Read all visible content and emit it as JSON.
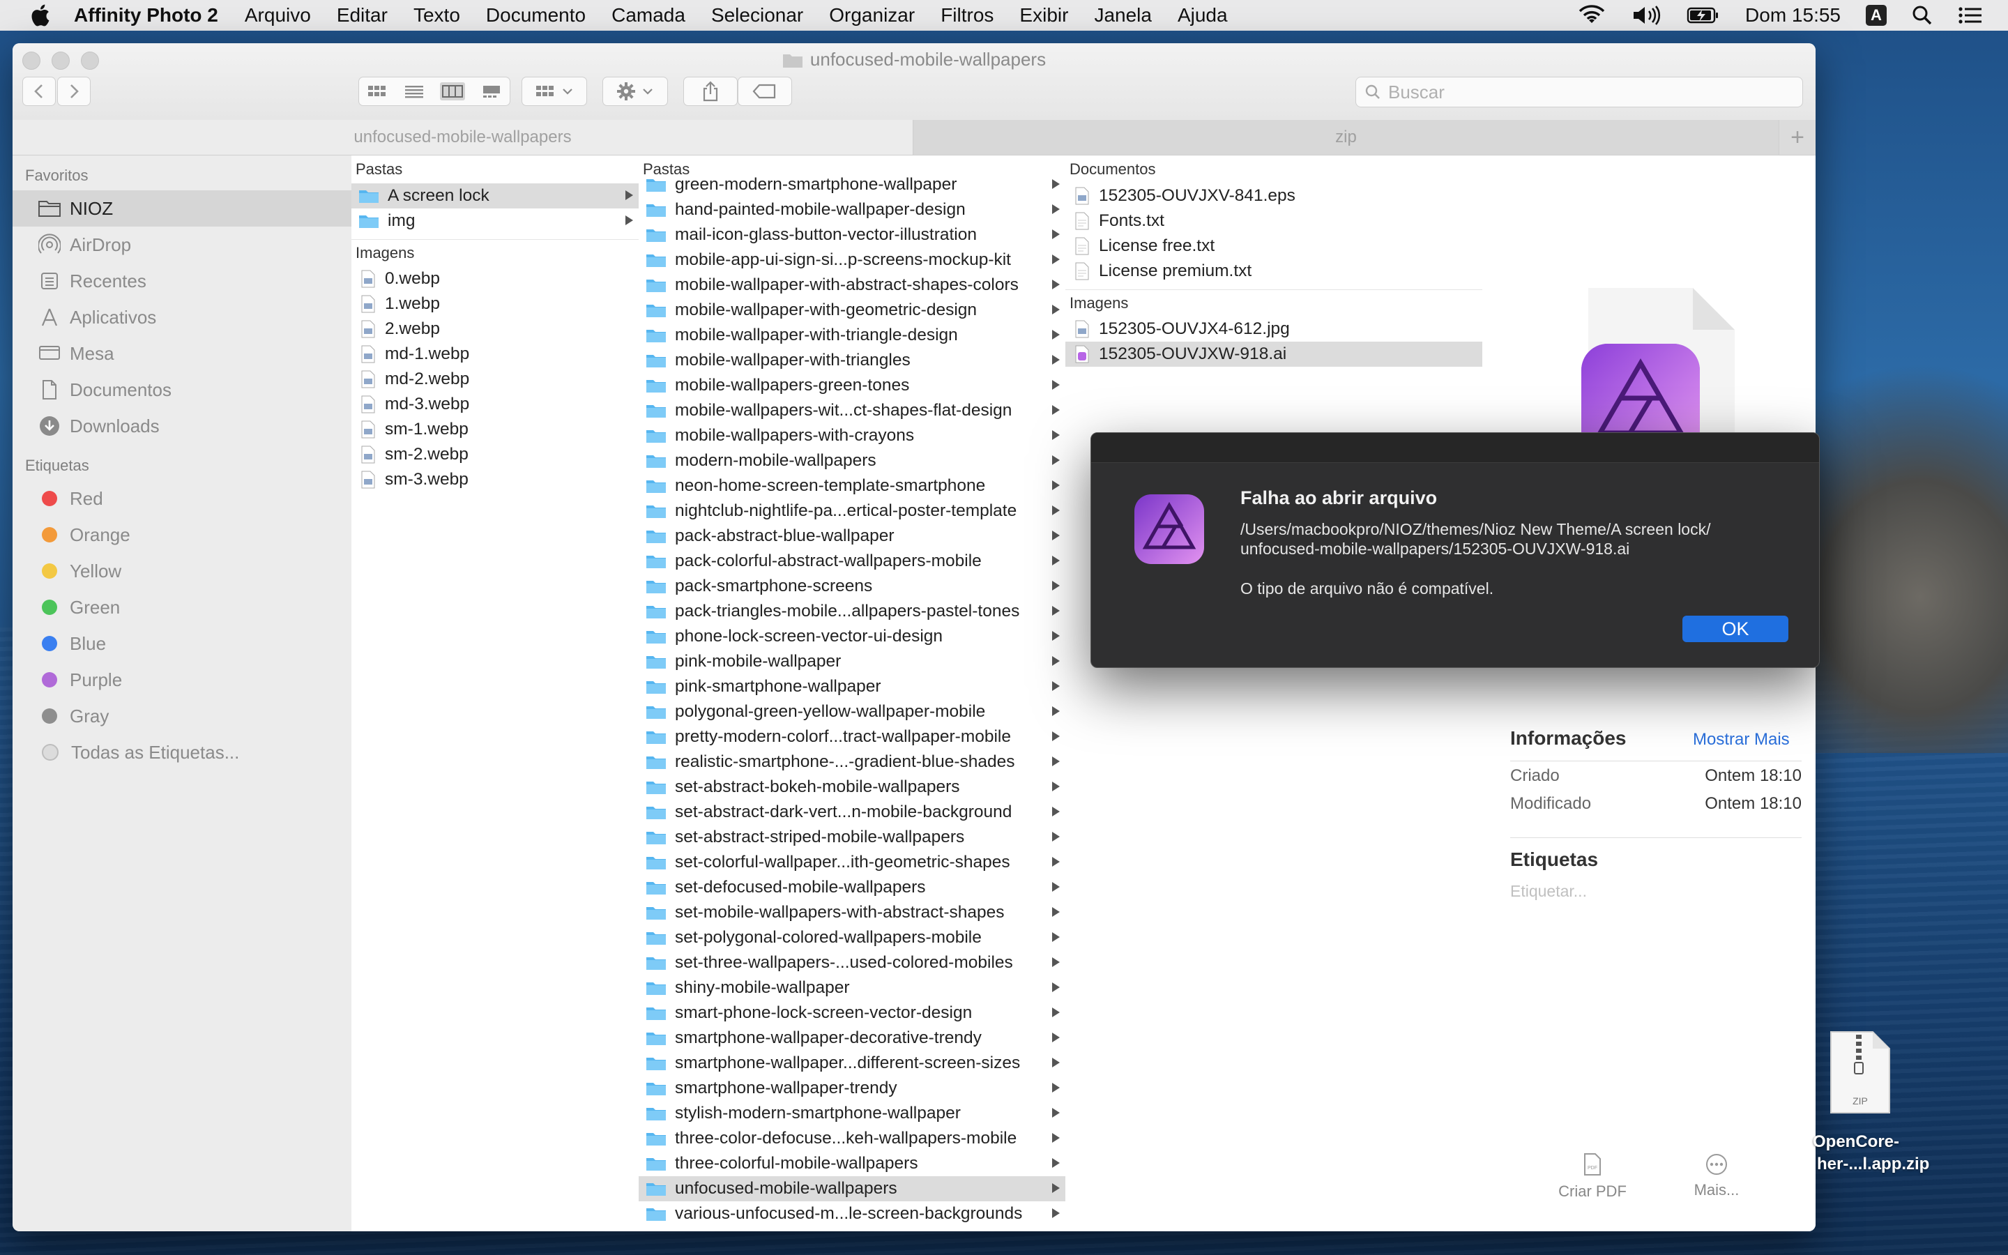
{
  "menubar": {
    "app_name": "Affinity Photo 2",
    "items": [
      "Arquivo",
      "Editar",
      "Texto",
      "Documento",
      "Camada",
      "Selecionar",
      "Organizar",
      "Filtros",
      "Exibir",
      "Janela",
      "Ajuda"
    ],
    "clock": "Dom 15:55",
    "input_source": "A"
  },
  "window": {
    "title": "unfocused-mobile-wallpapers",
    "search_placeholder": "Buscar",
    "tabs": [
      "unfocused-mobile-wallpapers",
      "zip"
    ],
    "tab_add": "+"
  },
  "sidebar": {
    "favorites_title": "Favoritos",
    "favorites": [
      "NIOZ",
      "AirDrop",
      "Recentes",
      "Aplicativos",
      "Mesa",
      "Documentos",
      "Downloads"
    ],
    "tags_title": "Etiquetas",
    "tags": [
      {
        "label": "Red",
        "color": "#ee4b4b"
      },
      {
        "label": "Orange",
        "color": "#f39a3a"
      },
      {
        "label": "Yellow",
        "color": "#f3c843"
      },
      {
        "label": "Green",
        "color": "#4cc45a"
      },
      {
        "label": "Blue",
        "color": "#3a7ff0"
      },
      {
        "label": "Purple",
        "color": "#b06ad8"
      },
      {
        "label": "Gray",
        "color": "#8e8e8e"
      }
    ],
    "all_tags": "Todas as Etiquetas..."
  },
  "col1": {
    "folders_head": "Pastas",
    "folders": [
      "A screen lock",
      "img"
    ],
    "images_head": "Imagens",
    "images": [
      "0.webp",
      "1.webp",
      "2.webp",
      "md-1.webp",
      "md-2.webp",
      "md-3.webp",
      "sm-1.webp",
      "sm-2.webp",
      "sm-3.webp"
    ]
  },
  "col2": {
    "head": "Pastas",
    "folders": [
      "green-modern-smartphone-wallpaper",
      "hand-painted-mobile-wallpaper-design",
      "mail-icon-glass-button-vector-illustration",
      "mobile-app-ui-sign-si...p-screens-mockup-kit",
      "mobile-wallpaper-with-abstract-shapes-colors",
      "mobile-wallpaper-with-geometric-design",
      "mobile-wallpaper-with-triangle-design",
      "mobile-wallpaper-with-triangles",
      "mobile-wallpapers-green-tones",
      "mobile-wallpapers-wit...ct-shapes-flat-design",
      "mobile-wallpapers-with-crayons",
      "modern-mobile-wallpapers",
      "neon-home-screen-template-smartphone",
      "nightclub-nightlife-pa...ertical-poster-template",
      "pack-abstract-blue-wallpaper",
      "pack-colorful-abstract-wallpapers-mobile",
      "pack-smartphone-screens",
      "pack-triangles-mobile...allpapers-pastel-tones",
      "phone-lock-screen-vector-ui-design",
      "pink-mobile-wallpaper",
      "pink-smartphone-wallpaper",
      "polygonal-green-yellow-wallpaper-mobile",
      "pretty-modern-colorf...tract-wallpaper-mobile",
      "realistic-smartphone-...-gradient-blue-shades",
      "set-abstract-bokeh-mobile-wallpapers",
      "set-abstract-dark-vert...n-mobile-background",
      "set-abstract-striped-mobile-wallpapers",
      "set-colorful-wallpaper...ith-geometric-shapes",
      "set-defocused-mobile-wallpapers",
      "set-mobile-wallpapers-with-abstract-shapes",
      "set-polygonal-colored-wallpapers-mobile",
      "set-three-wallpapers-...used-colored-mobiles",
      "shiny-mobile-wallpaper",
      "smart-phone-lock-screen-vector-design",
      "smartphone-wallpaper-decorative-trendy",
      "smartphone-wallpaper...different-screen-sizes",
      "smartphone-wallpaper-trendy",
      "stylish-modern-smartphone-wallpaper",
      "three-color-defocuse...keh-wallpapers-mobile",
      "three-colorful-mobile-wallpapers",
      "unfocused-mobile-wallpapers",
      "various-unfocused-m...le-screen-backgrounds"
    ]
  },
  "col3": {
    "docs_head": "Documentos",
    "docs": [
      "152305-OUVJXV-841.eps",
      "Fonts.txt",
      "License free.txt",
      "License premium.txt"
    ],
    "images_head": "Imagens",
    "images": [
      "152305-OUVJX4-612.jpg",
      "152305-OUVJXW-918.ai"
    ]
  },
  "preview": {
    "info_title": "Informações",
    "show_more": "Mostrar Mais",
    "created_label": "Criado",
    "created_value": "Ontem 18:10",
    "modified_label": "Modificado",
    "modified_value": "Ontem 18:10",
    "tags_title": "Etiquetas",
    "tags_placeholder": "Etiquetar...",
    "create_pdf": "Criar PDF",
    "more": "Mais...",
    "pdf_glyph": "PDF"
  },
  "dialog": {
    "title": "Falha ao abrir arquivo",
    "path_line1": "/Users/macbookpro/NIOZ/themes/Nioz New Theme/A screen lock/",
    "path_line2": "unfocused-mobile-wallpapers/152305-OUVJXW-918.ai",
    "message": "O tipo de arquivo não é compatível.",
    "ok": "OK"
  },
  "desktop": {
    "zip_badge": "ZIP",
    "zip_label_line1": "OpenCore-",
    "zip_label_line2": "her-...l.app.zip"
  }
}
